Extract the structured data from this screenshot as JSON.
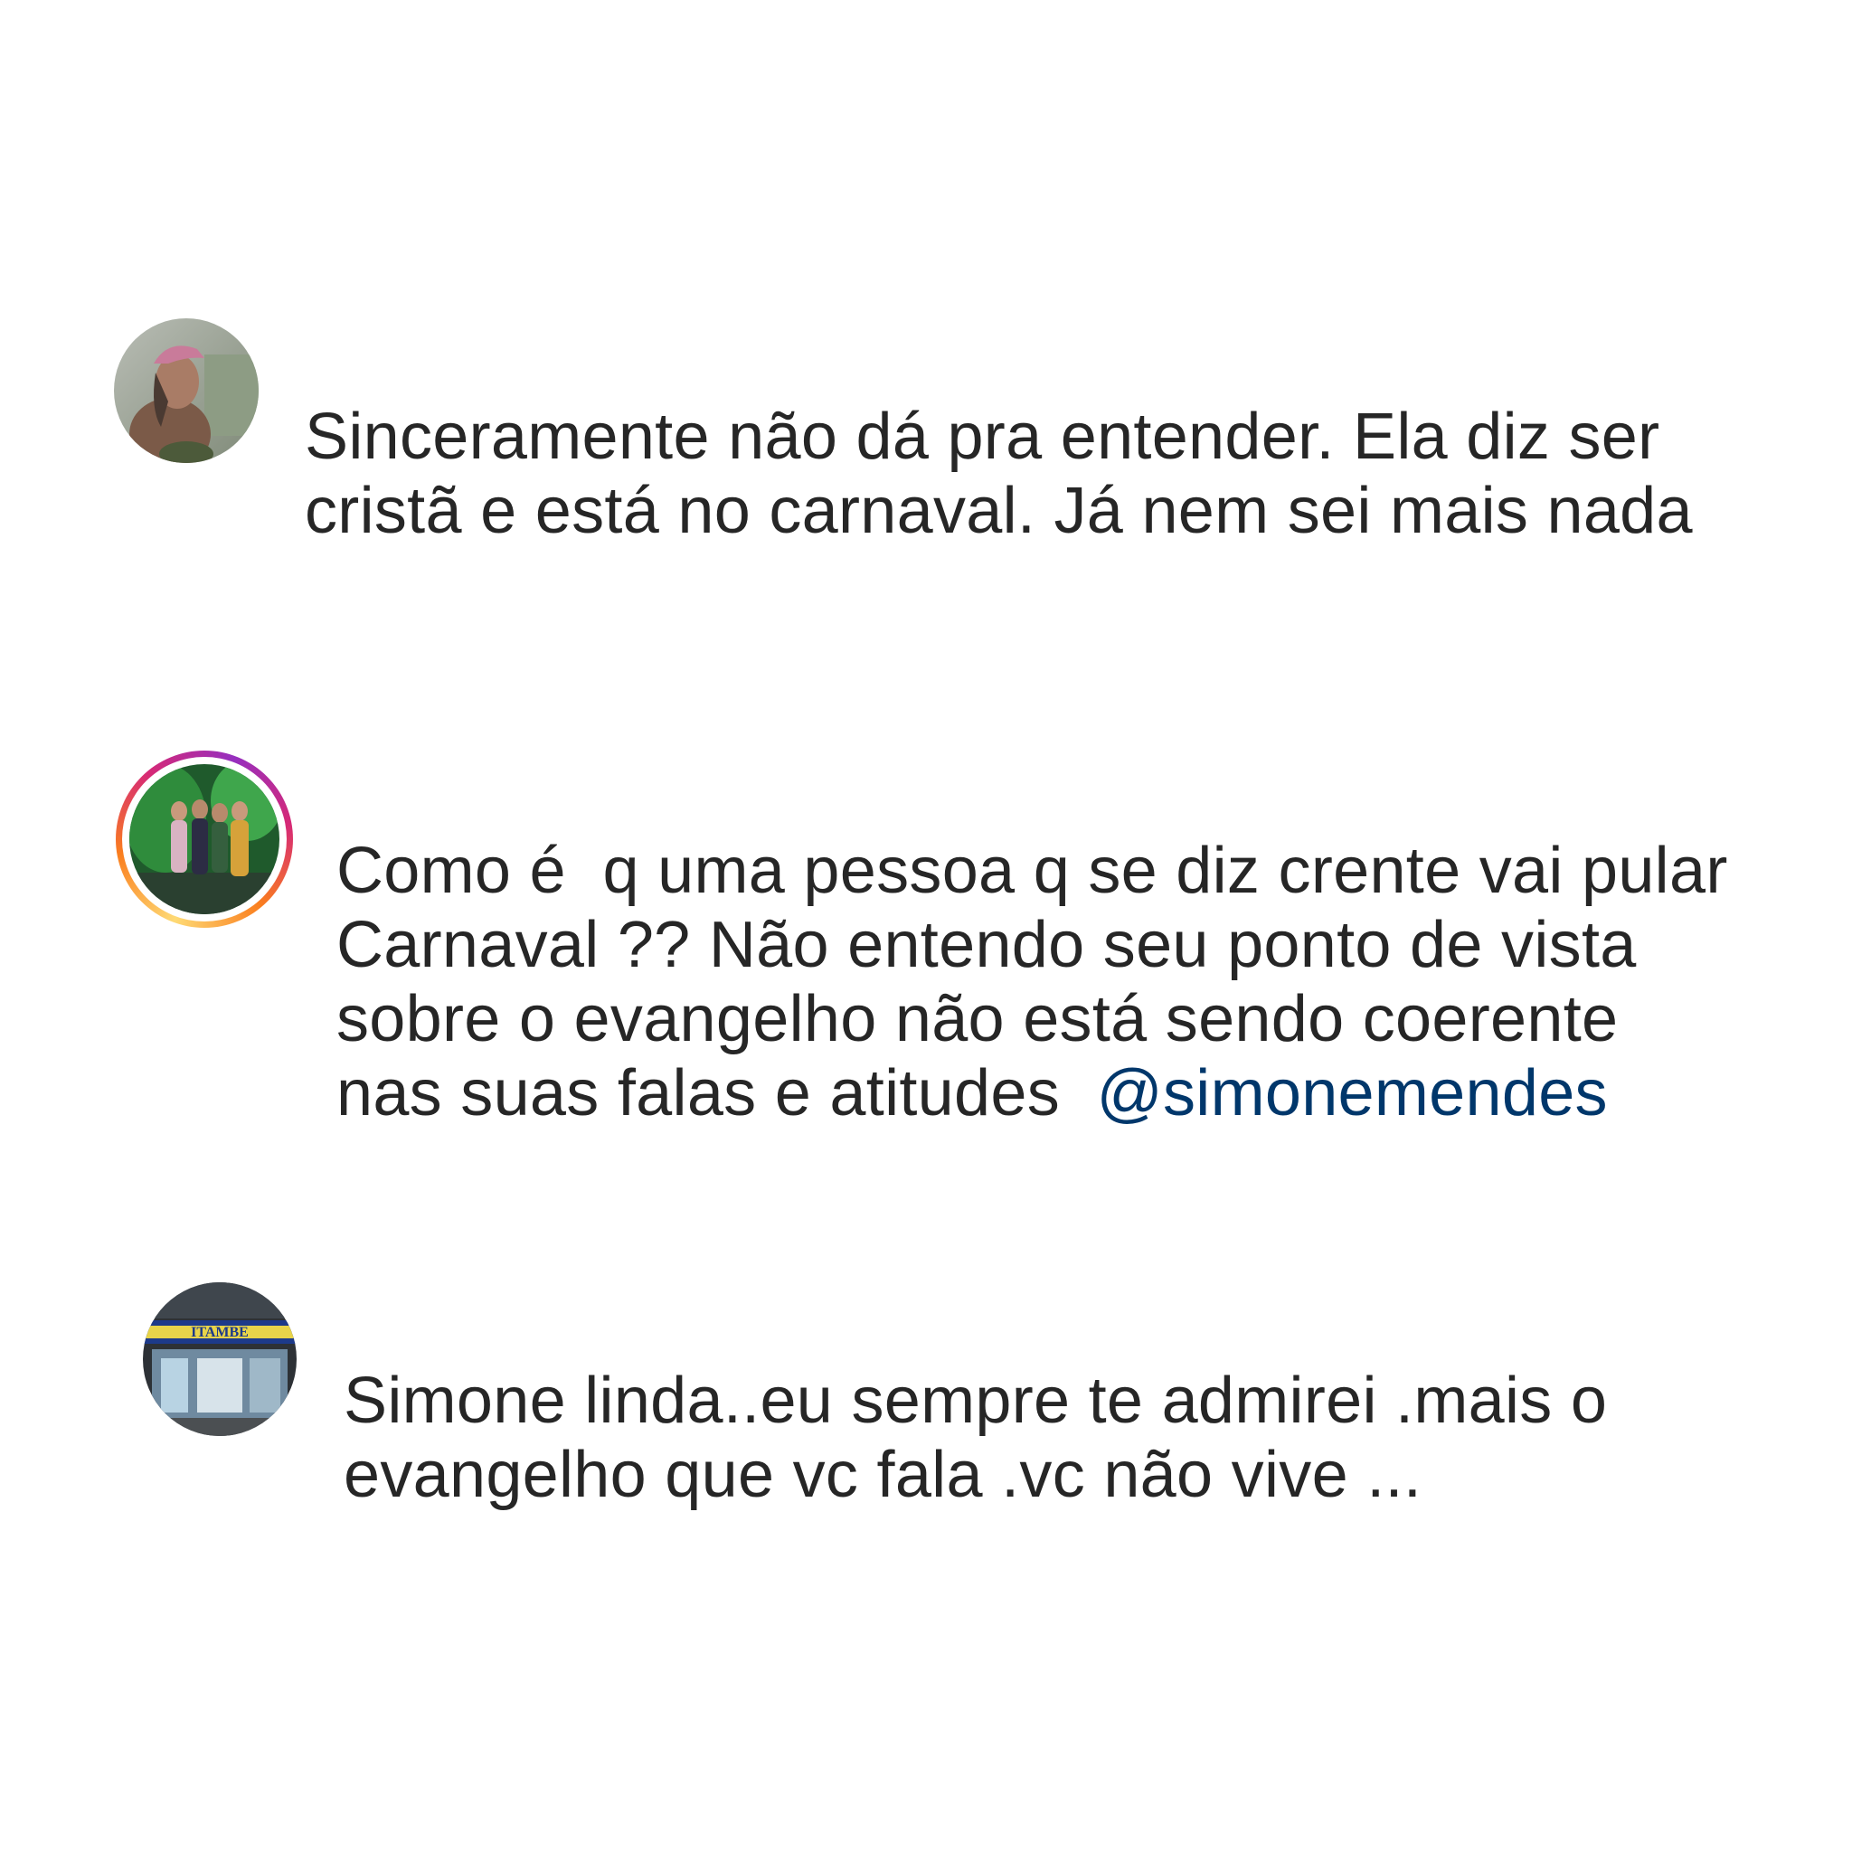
{
  "comments": [
    {
      "text": "Sinceramente não dá pra entender. Ela diz ser cristã e está no carnaval. Já nem sei mais nada",
      "lines": [
        "Sinceramente não dá pra entender. Ela diz ser",
        "cristã e está no carnaval. Já nem sei mais nada"
      ],
      "avatar_icon": "profile-photo-woman-pink-cap",
      "has_story_ring": false
    },
    {
      "text": "Como é  q uma pessoa q se diz crente vai pular Carnaval ?? Não entendo seu ponto de vista sobre o evangelho não está sendo coerente nas suas falas e atitudes",
      "lines": [
        "Como é  q uma pessoa q se diz crente vai pular",
        "Carnaval ?? Não entendo seu ponto de vista",
        "sobre o evangelho não está sendo coerente",
        "nas suas falas e atitudes  "
      ],
      "mention": "@simonemendes",
      "avatar_icon": "profile-photo-group-green-background",
      "has_story_ring": true,
      "ring_colors": [
        "#feda75",
        "#fa7e1e",
        "#d62976",
        "#962fbf"
      ]
    },
    {
      "text": "Simone linda..eu sempre te admirei .mais o evangelho que vc fala .vc não vive ...",
      "lines": [
        "Simone linda..eu sempre te admirei .mais o",
        "evangelho que vc fala .vc não vive ..."
      ],
      "avatar_icon": "profile-photo-storefront-itambe",
      "avatar_sign_text": "ITAMBE",
      "has_story_ring": false
    }
  ],
  "colors": {
    "text": "#262626",
    "mention": "#00376b",
    "background": "#ffffff"
  }
}
